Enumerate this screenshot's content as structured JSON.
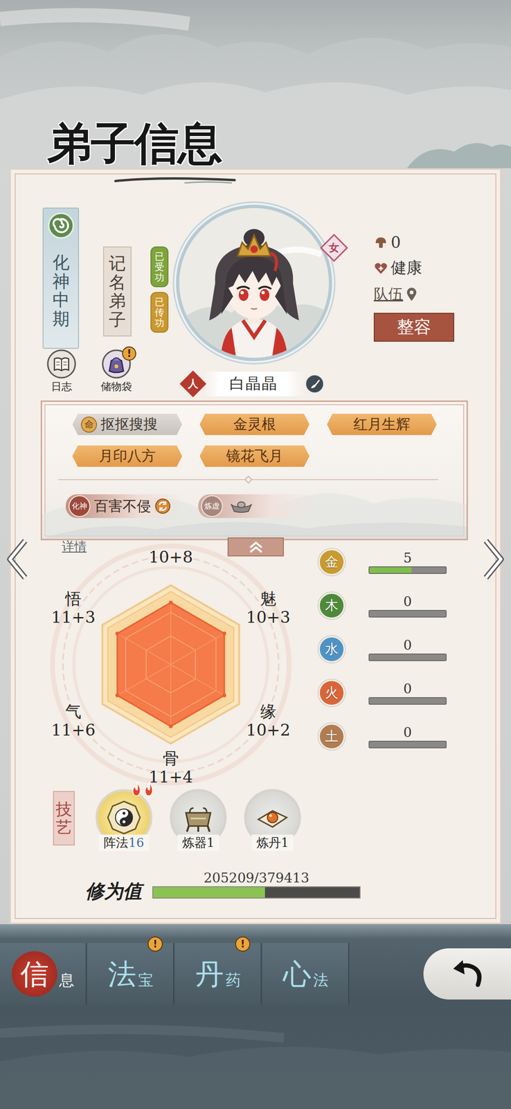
{
  "title": "弟子信息",
  "disciple": {
    "realm": "化神中期",
    "rank": "记名弟子",
    "badges": [
      {
        "label": "已受功",
        "color": "#7ea43c"
      },
      {
        "label": "已传功",
        "color": "#c9982f"
      }
    ],
    "gender": "女",
    "race": "人",
    "name": "白晶晶",
    "mood": "0",
    "health": "健康",
    "team": "队伍",
    "makeover_button": "整容"
  },
  "shortcuts": [
    {
      "label": "日志",
      "alert": false
    },
    {
      "label": "储物袋",
      "alert": true
    }
  ],
  "alert_mark": "!",
  "traits": [
    {
      "label": "抠抠搜搜",
      "kind": "fate",
      "prefix": "命"
    },
    {
      "label": "金灵根",
      "kind": "normal"
    },
    {
      "label": "红月生辉",
      "kind": "normal"
    },
    {
      "label": "月印八方",
      "kind": "normal"
    },
    {
      "label": "镜花飞月",
      "kind": "normal"
    }
  ],
  "abilities": [
    {
      "stage": "化神",
      "label": "百害不侵",
      "kind": "learned"
    },
    {
      "stage": "炼虚",
      "kind": "locked"
    }
  ],
  "details_link": "详情",
  "attributes": [
    {
      "value": "10+8",
      "level": 0.85
    },
    {
      "label": "魅",
      "value": "10+3",
      "level": 0.85
    },
    {
      "label": "缘",
      "value": "10+2",
      "level": 0.85
    },
    {
      "label": "骨",
      "value": "11+4",
      "level": 0.85
    },
    {
      "label": "气",
      "value": "11+6",
      "level": 0.85
    },
    {
      "label": "悟",
      "value": "11+3",
      "level": 0.85
    }
  ],
  "elements": [
    {
      "label": "金",
      "value": "5",
      "level": 0.55,
      "color": "#c99b2e"
    },
    {
      "label": "木",
      "value": "0",
      "level": 0,
      "color": "#4e8a3a"
    },
    {
      "label": "水",
      "value": "0",
      "level": 0,
      "color": "#4f93c4"
    },
    {
      "label": "火",
      "value": "0",
      "level": 0,
      "color": "#d9663a"
    },
    {
      "label": "土",
      "value": "0",
      "level": 0,
      "color": "#b07d52"
    }
  ],
  "skills_label": "技艺",
  "skills": [
    {
      "label": "阵法",
      "value": "16",
      "active": true,
      "flames": 2
    },
    {
      "label": "炼器",
      "value": "1",
      "active": false,
      "flames": 0
    },
    {
      "label": "炼丹",
      "value": "1",
      "active": false,
      "flames": 0
    }
  ],
  "cultivation": {
    "label": "修为值",
    "reading": "205209/379413",
    "level": 0.541
  },
  "nav": [
    {
      "main": "信",
      "sub": "息",
      "selected": true,
      "alert": false
    },
    {
      "main": "法",
      "sub": "宝",
      "selected": false,
      "alert": true
    },
    {
      "main": "丹",
      "sub": "药",
      "selected": false,
      "alert": true
    },
    {
      "main": "心",
      "sub": "法",
      "selected": false,
      "alert": false
    }
  ]
}
